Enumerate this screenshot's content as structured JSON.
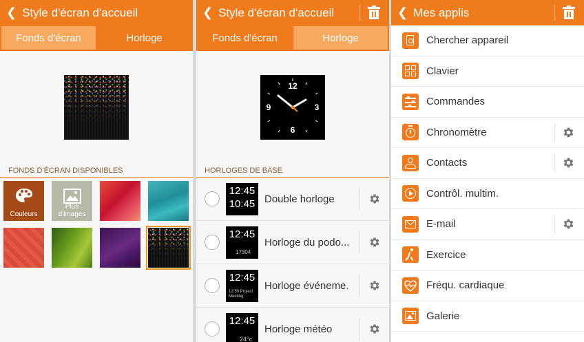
{
  "panel1": {
    "back_icon": "back-chevron-icon",
    "title": "Style d'écran d'accueil",
    "tabs": [
      "Fonds d'écran",
      "Horloge"
    ],
    "active_tab": 0,
    "section_title": "FONDS D'ÉCRAN DISPONIBLES",
    "wallpapers": [
      {
        "label": "Couleurs",
        "icon": "palette-icon"
      },
      {
        "label": "Plus d'images",
        "icon": "image-icon"
      },
      {
        "label": ""
      },
      {
        "label": ""
      },
      {
        "label": ""
      },
      {
        "label": ""
      },
      {
        "label": ""
      },
      {
        "label": "",
        "selected": true
      }
    ]
  },
  "panel2": {
    "back_icon": "back-chevron-icon",
    "title": "Style d'écran d'accueil",
    "delete_icon": "trash-icon",
    "tabs": [
      "Fonds d'écran",
      "Horloge"
    ],
    "active_tab": 1,
    "clock_numbers": [
      "12",
      "3",
      "6",
      "9"
    ],
    "section_title": "HORLOGES DE BASE",
    "clocks": [
      {
        "label": "Double horloge",
        "time1": "12:45",
        "time2": "10:45",
        "extra": ""
      },
      {
        "label": "Horloge du podo...",
        "time1": "12:45",
        "time2": "",
        "extra": "17304"
      },
      {
        "label": "Horloge événeme...",
        "time1": "12:45",
        "time2": "",
        "extra": "12:50 Project Meeting"
      },
      {
        "label": "Horloge météo",
        "time1": "12:45",
        "time2": "",
        "extra": "24°c"
      }
    ]
  },
  "panel3": {
    "back_icon": "back-chevron-icon",
    "title": "Mes applis",
    "delete_icon": "trash-icon",
    "apps": [
      {
        "label": "Chercher appareil",
        "icon": "find-device-icon",
        "settings": false
      },
      {
        "label": "Clavier",
        "icon": "keyboard-icon",
        "settings": false
      },
      {
        "label": "Commandes",
        "icon": "sliders-icon",
        "settings": false
      },
      {
        "label": "Chronomètre",
        "icon": "stopwatch-icon",
        "settings": true
      },
      {
        "label": "Contacts",
        "icon": "contact-icon",
        "settings": true
      },
      {
        "label": "Contrôl. multim.",
        "icon": "play-icon",
        "settings": false
      },
      {
        "label": "E-mail",
        "icon": "email-icon",
        "settings": true
      },
      {
        "label": "Exercice",
        "icon": "runner-icon",
        "settings": false
      },
      {
        "label": "Fréqu. cardiaque",
        "icon": "heart-rate-icon",
        "settings": false
      },
      {
        "label": "Galerie",
        "icon": "gallery-icon",
        "settings": false
      }
    ]
  },
  "colors": {
    "accent": "#ef7b1c",
    "tab_active": "#f8a85f",
    "section_text": "#8c5a32"
  }
}
